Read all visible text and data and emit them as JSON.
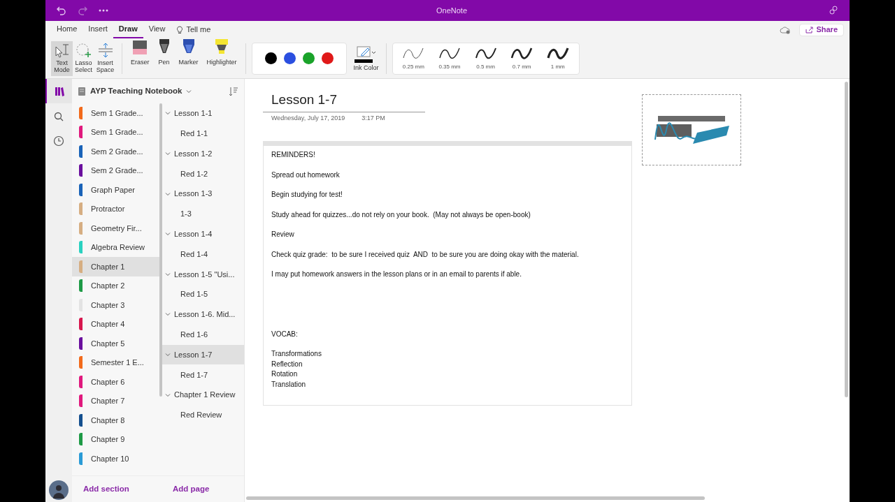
{
  "window": {
    "title": "OneNote"
  },
  "menu_tabs": [
    {
      "label": "Home",
      "selected": false
    },
    {
      "label": "Insert",
      "selected": false
    },
    {
      "label": "Draw",
      "selected": true
    },
    {
      "label": "View",
      "selected": false
    },
    {
      "label": "Tell me",
      "selected": false,
      "kind": "search"
    }
  ],
  "share": {
    "label": "Share"
  },
  "ribbon": {
    "tools": [
      {
        "label": "Text Mode",
        "kind": "text",
        "selected": true
      },
      {
        "label": "Lasso Select",
        "kind": "lasso",
        "selected": false
      },
      {
        "label": "Insert Space",
        "kind": "space",
        "selected": false
      }
    ],
    "pens": [
      {
        "label": "Eraser",
        "kind": "eraser"
      },
      {
        "label": "Pen",
        "kind": "pen"
      },
      {
        "label": "Marker",
        "kind": "marker"
      },
      {
        "label": "Highlighter",
        "kind": "highlighter"
      }
    ],
    "ink_colors": [
      {
        "color": "#000000"
      },
      {
        "color": "#2b4fe0"
      },
      {
        "color": "#1aa32a"
      },
      {
        "color": "#e01919"
      }
    ],
    "ink_color": {
      "label": "Ink Color",
      "color": "#000000"
    },
    "thicknesses": [
      {
        "label": "0.25 mm"
      },
      {
        "label": "0.35 mm"
      },
      {
        "label": "0.5 mm"
      },
      {
        "label": "0.7 mm"
      },
      {
        "label": "1 mm"
      }
    ]
  },
  "notebook": {
    "title": "AYP Teaching Notebook"
  },
  "sections": [
    {
      "label": "Sem 1 Grade...",
      "color": "#f26a1b",
      "selected": false
    },
    {
      "label": "Sem 1 Grade...",
      "color": "#e0197d",
      "selected": false
    },
    {
      "label": "Sem 2 Grade...",
      "color": "#1a63b8",
      "selected": false
    },
    {
      "label": "Sem 2 Grade...",
      "color": "#6a0f9e",
      "selected": false
    },
    {
      "label": "Graph Paper",
      "color": "#1a63b8",
      "selected": false
    },
    {
      "label": "Protractor",
      "color": "#d6ae82",
      "selected": false
    },
    {
      "label": "Geometry Fir...",
      "color": "#d6ae82",
      "selected": false
    },
    {
      "label": "Algebra Review",
      "color": "#2ad1c0",
      "selected": false
    },
    {
      "label": "Chapter 1",
      "color": "#d6ae82",
      "selected": true
    },
    {
      "label": "Chapter 2",
      "color": "#1e9a46",
      "selected": false
    },
    {
      "label": "Chapter 3",
      "color": "#e3e3e3",
      "selected": false
    },
    {
      "label": "Chapter 4",
      "color": "#d7174e",
      "selected": false
    },
    {
      "label": "Chapter 5",
      "color": "#6a0f9e",
      "selected": false
    },
    {
      "label": "Semester 1 E...",
      "color": "#f26a1b",
      "selected": false
    },
    {
      "label": "Chapter 6",
      "color": "#e0197d",
      "selected": false
    },
    {
      "label": "Chapter 7",
      "color": "#e0197d",
      "selected": false
    },
    {
      "label": "Chapter 8",
      "color": "#15508f",
      "selected": false
    },
    {
      "label": "Chapter 9",
      "color": "#1e9a46",
      "selected": false
    },
    {
      "label": "Chapter 10",
      "color": "#2a9bd6",
      "selected": false
    }
  ],
  "pages": [
    {
      "label": "Lesson 1-1",
      "expanded": true,
      "selected": false,
      "children": [
        {
          "label": "Red 1-1",
          "selected": false
        }
      ]
    },
    {
      "label": "Lesson 1-2",
      "expanded": true,
      "selected": false,
      "children": [
        {
          "label": "Red 1-2",
          "selected": false
        }
      ]
    },
    {
      "label": "Lesson 1-3",
      "expanded": true,
      "selected": false,
      "children": [
        {
          "label": "1-3",
          "selected": false
        }
      ]
    },
    {
      "label": "Lesson 1-4",
      "expanded": true,
      "selected": false,
      "children": [
        {
          "label": "Red 1-4",
          "selected": false
        }
      ]
    },
    {
      "label": "Lesson 1-5 \"Usi...",
      "expanded": true,
      "selected": false,
      "children": [
        {
          "label": "Red 1-5",
          "selected": false
        }
      ]
    },
    {
      "label": "Lesson 1-6. Mid...",
      "expanded": true,
      "selected": false,
      "children": [
        {
          "label": "Red 1-6",
          "selected": false
        }
      ]
    },
    {
      "label": "Lesson 1-7",
      "expanded": true,
      "selected": true,
      "children": [
        {
          "label": "Red 1-7",
          "selected": false
        }
      ]
    },
    {
      "label": "Chapter 1 Review",
      "expanded": true,
      "selected": false,
      "children": [
        {
          "label": "Red Review",
          "selected": false
        }
      ]
    }
  ],
  "footer": {
    "add_section": "Add section",
    "add_page": "Add page"
  },
  "page": {
    "title": "Lesson 1-7",
    "date": "Wednesday, July 17, 2019",
    "time": "3:17 PM",
    "note": [
      {
        "kind": "paragraph",
        "lines": [
          "REMINDERS!"
        ]
      },
      {
        "kind": "paragraph",
        "lines": [
          "Spread out homework"
        ]
      },
      {
        "kind": "paragraph",
        "lines": [
          "Begin studying for test!"
        ]
      },
      {
        "kind": "paragraph",
        "lines": [
          "Study ahead for quizzes...do not rely on your book.  (May not always be open-book)"
        ]
      },
      {
        "kind": "paragraph",
        "lines": [
          "Review"
        ]
      },
      {
        "kind": "paragraph",
        "lines": [
          "Check quiz grade:  to be sure I received quiz  AND  to be sure you are doing okay with the material."
        ]
      },
      {
        "kind": "paragraph",
        "lines": [
          "I may put homework answers in the lesson plans or in an email to parents if able."
        ]
      },
      {
        "kind": "spaced",
        "lines": [
          "VOCAB:"
        ]
      },
      {
        "kind": "paragraph",
        "lines": [
          "Transformations",
          "Reflection",
          "Rotation",
          "Translation"
        ]
      }
    ],
    "image": {
      "kind": "picture",
      "selected": true
    }
  }
}
